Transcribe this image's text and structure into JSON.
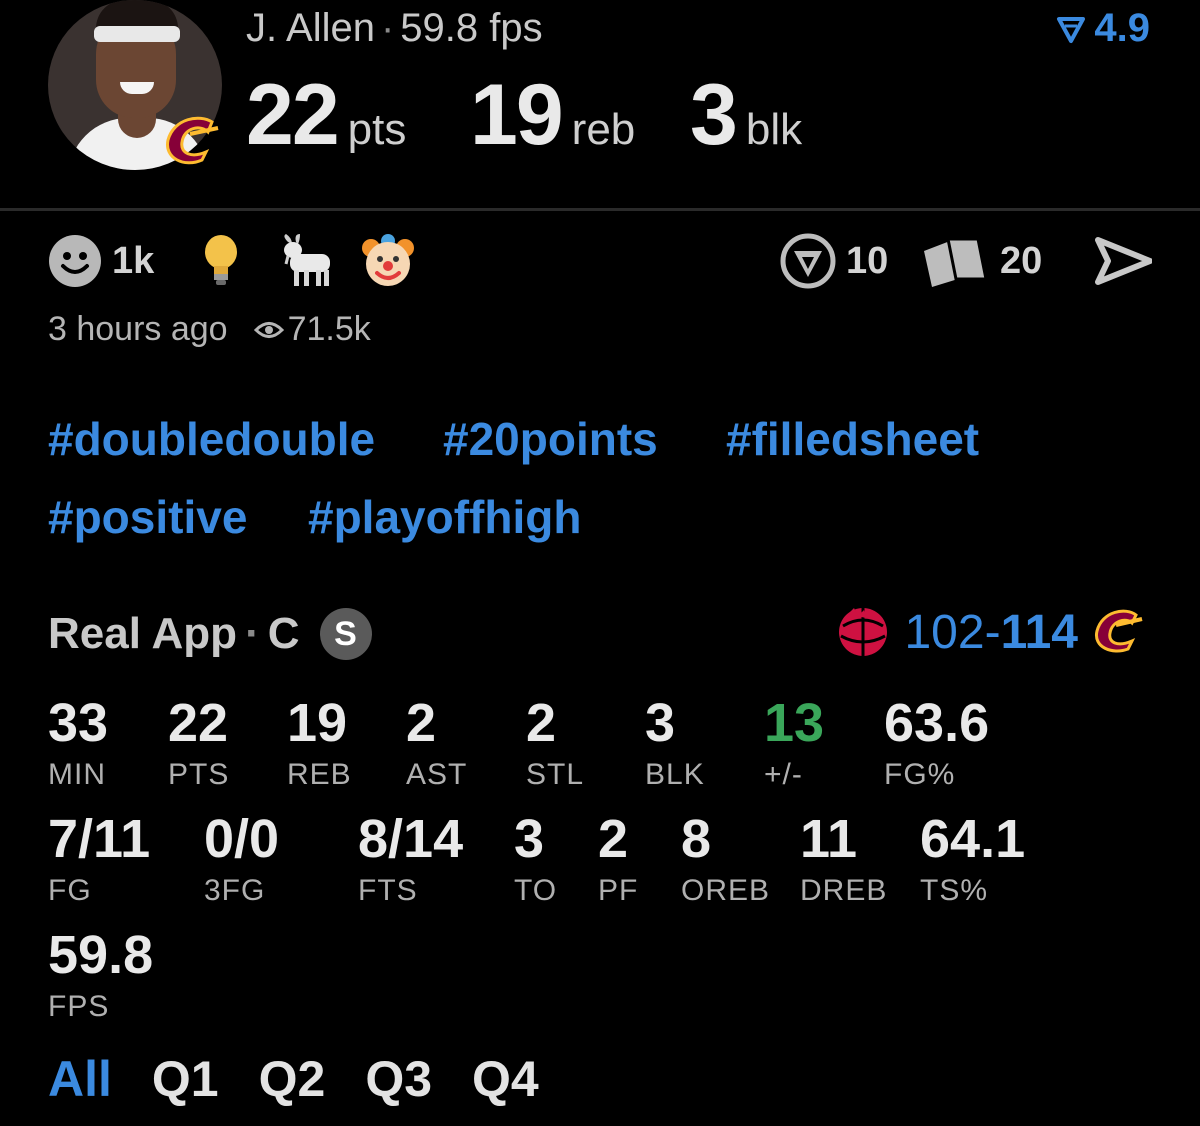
{
  "header": {
    "player_name": "J. Allen",
    "separator": "·",
    "fps_text": "59.8 fps",
    "rating_value": "4.9",
    "big_stats": [
      {
        "value": "22",
        "unit": "pts"
      },
      {
        "value": "19",
        "unit": "reb"
      },
      {
        "value": "3",
        "unit": "blk"
      }
    ]
  },
  "reactions": {
    "smile_count": "1k",
    "icons": [
      "smile-icon",
      "lightbulb-icon",
      "goat-icon",
      "clown-icon"
    ],
    "comment_count": "10",
    "cards_count": "20",
    "share_icon": "send-icon"
  },
  "meta": {
    "time_ago": "3 hours ago",
    "views": "71.5k"
  },
  "hashtags": [
    "#doubledouble",
    "#20points",
    "#filledsheet",
    "#positive",
    "#playoffhigh"
  ],
  "source": {
    "app": "Real App",
    "separator": "·",
    "position": "C",
    "badge": "S"
  },
  "game": {
    "home_score": "102",
    "dash": "-",
    "away_score": "114",
    "colors": {
      "raptors": "#ce1141",
      "cavs": "#860038",
      "accent": "#3b8ae0",
      "positive": "#3aa65a"
    }
  },
  "stats_row1": [
    {
      "value": "33",
      "label": "MIN"
    },
    {
      "value": "22",
      "label": "PTS"
    },
    {
      "value": "19",
      "label": "REB"
    },
    {
      "value": "2",
      "label": "AST"
    },
    {
      "value": "2",
      "label": "STL"
    },
    {
      "value": "3",
      "label": "BLK"
    },
    {
      "value": "13",
      "label": "+/-"
    },
    {
      "value": "63.6",
      "label": "FG%"
    }
  ],
  "stats_row2": [
    {
      "value": "7/11",
      "label": "FG"
    },
    {
      "value": "0/0",
      "label": "3FG"
    },
    {
      "value": "8/14",
      "label": "FTS"
    },
    {
      "value": "3",
      "label": "TO"
    },
    {
      "value": "2",
      "label": "PF"
    },
    {
      "value": "8",
      "label": "OREB"
    },
    {
      "value": "11",
      "label": "DREB"
    },
    {
      "value": "64.1",
      "label": "TS%"
    }
  ],
  "stats_row3": [
    {
      "value": "59.8",
      "label": "FPS"
    }
  ],
  "tabs": [
    "All",
    "Q1",
    "Q2",
    "Q3",
    "Q4"
  ]
}
